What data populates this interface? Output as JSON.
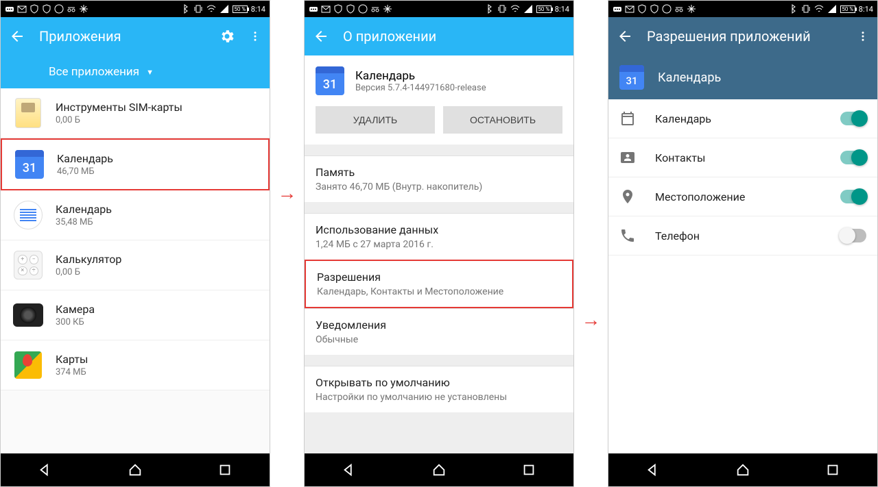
{
  "status": {
    "battery": "50 %",
    "time": "8:14"
  },
  "screen1": {
    "title": "Приложения",
    "tab": "Все приложения",
    "items": [
      {
        "name": "Инструменты SIM-карты",
        "size": "0,00 Б"
      },
      {
        "name": "Календарь",
        "size": "46,70 МБ",
        "highlight": true,
        "icon_day": "31"
      },
      {
        "name": "Календарь",
        "size": "35,48 МБ"
      },
      {
        "name": "Калькулятор",
        "size": "0,00 Б"
      },
      {
        "name": "Камера",
        "size": "300 КБ"
      },
      {
        "name": "Карты",
        "size": "374 МБ"
      }
    ]
  },
  "screen2": {
    "title": "О приложении",
    "app_name": "Календарь",
    "version": "Версия 5.7.4-144971680-release",
    "icon_day": "31",
    "btn_uninstall": "УДАЛИТЬ",
    "btn_stop": "ОСТАНОВИТЬ",
    "items": [
      {
        "primary": "Память",
        "secondary": "Занято 46,70 МБ (Внутр. накопитель)"
      },
      {
        "primary": "Использование данных",
        "secondary": "1,24 МБ с 27 марта 2016 г."
      },
      {
        "primary": "Разрешения",
        "secondary": "Календарь, Контакты и Местоположение",
        "highlight": true
      },
      {
        "primary": "Уведомления",
        "secondary": "Обычные"
      },
      {
        "primary": "Открывать по умолчанию",
        "secondary": "Настройки по умолчанию не установлены"
      }
    ]
  },
  "screen3": {
    "title": "Разрешения приложений",
    "app_name": "Календарь",
    "icon_day": "31",
    "perms": [
      {
        "label": "Календарь",
        "on": true
      },
      {
        "label": "Контакты",
        "on": true
      },
      {
        "label": "Местоположение",
        "on": true
      },
      {
        "label": "Телефон",
        "on": false
      }
    ]
  }
}
